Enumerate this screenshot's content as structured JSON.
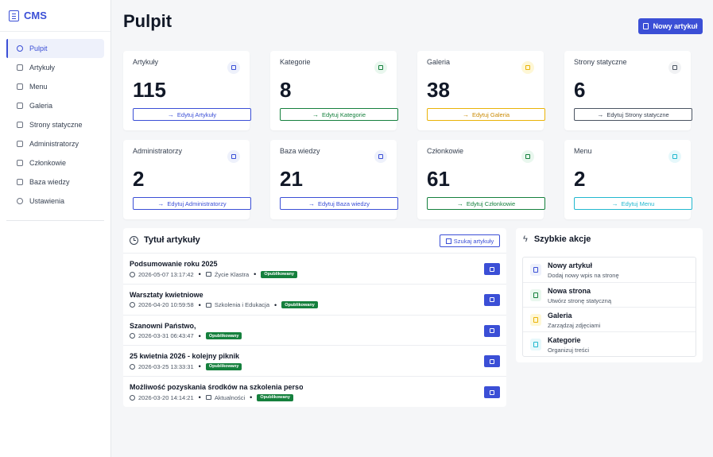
{
  "brand": {
    "name": "CMS"
  },
  "sidebar": {
    "items": [
      {
        "label": "Pulpit",
        "active": true
      },
      {
        "label": "Artykuły"
      },
      {
        "label": "Menu"
      },
      {
        "label": "Galeria"
      },
      {
        "label": "Strony statyczne"
      },
      {
        "label": "Administratorzy"
      },
      {
        "label": "Członkowie"
      },
      {
        "label": "Baza wiedzy"
      },
      {
        "label": "Ustawienia"
      }
    ]
  },
  "header": {
    "title": "Pulpit",
    "new_button": "Nowy artykuł"
  },
  "stats": [
    {
      "label": "Artykuły",
      "value": "115",
      "edit": "Edytuj Artykuły",
      "color": "#3b4fd6",
      "icon_bg": "#eef1fb"
    },
    {
      "label": "Kategorie",
      "value": "8",
      "edit": "Edytuj Kategorie",
      "color": "#15803d",
      "icon_bg": "#e9f7ee"
    },
    {
      "label": "Galeria",
      "value": "38",
      "edit": "Edytuj Galeria",
      "color": "#eab308",
      "icon_bg": "#fef7d6"
    },
    {
      "label": "Strony statyczne",
      "value": "6",
      "edit": "Edytuj Strony statyczne",
      "color": "#4b5563",
      "icon_bg": "#f1f2f4"
    },
    {
      "label": "Administratorzy",
      "value": "2",
      "edit": "Edytuj Administratorzy",
      "color": "#3b4fd6",
      "icon_bg": "#eef1fb"
    },
    {
      "label": "Baza wiedzy",
      "value": "21",
      "edit": "Edytuj Baza wiedzy",
      "color": "#3b4fd6",
      "icon_bg": "#eef1fb"
    },
    {
      "label": "Członkowie",
      "value": "61",
      "edit": "Edytuj Członkowie",
      "color": "#15803d",
      "icon_bg": "#e9f7ee"
    },
    {
      "label": "Menu",
      "value": "2",
      "edit": "Edytuj Menu",
      "color": "#22b8cf",
      "icon_bg": "#e6f8fb"
    }
  ],
  "articles": {
    "title": "Tytuł artykuły",
    "search_label": "Szukaj artykuły",
    "rows": [
      {
        "title": "Podsumowanie roku 2025",
        "date": "2026-05-07 13:17:42",
        "category": "Życie Klastra",
        "status": "Opublikowany"
      },
      {
        "title": "Warsztaty kwietniowe",
        "date": "2026-04-20 10:59:58",
        "category": "Szkolenia i Edukacja",
        "status": "Opublikowany"
      },
      {
        "title": "Szanowni Państwo,",
        "date": "2026-03-31 06:43:47",
        "category": "",
        "status": "Opublikowany"
      },
      {
        "title": "25 kwietnia 2026 - kolejny piknik",
        "date": "2026-03-25 13:33:31",
        "category": "",
        "status": "Opublikowany"
      },
      {
        "title": "Możliwość pozyskania środków na szkolenia personelu i",
        "date": "2026-03-20 14:14:21",
        "category": "Aktualności",
        "status": "Opublikowany"
      }
    ]
  },
  "quick_actions": {
    "title": "Szybkie akcje",
    "items": [
      {
        "name": "Nowy artykuł",
        "desc": "Dodaj nowy wpis na stronę",
        "color": "#3b4fd6",
        "bg": "#eef1fb"
      },
      {
        "name": "Nowa strona",
        "desc": "Utwórz stronę statyczną",
        "color": "#15803d",
        "bg": "#e9f7ee"
      },
      {
        "name": "Galeria",
        "desc": "Zarządzaj zdjęciami",
        "color": "#eab308",
        "bg": "#fef7d6"
      },
      {
        "name": "Kategorie",
        "desc": "Organizuj treści",
        "color": "#22b8cf",
        "bg": "#e6f8fb"
      }
    ]
  }
}
